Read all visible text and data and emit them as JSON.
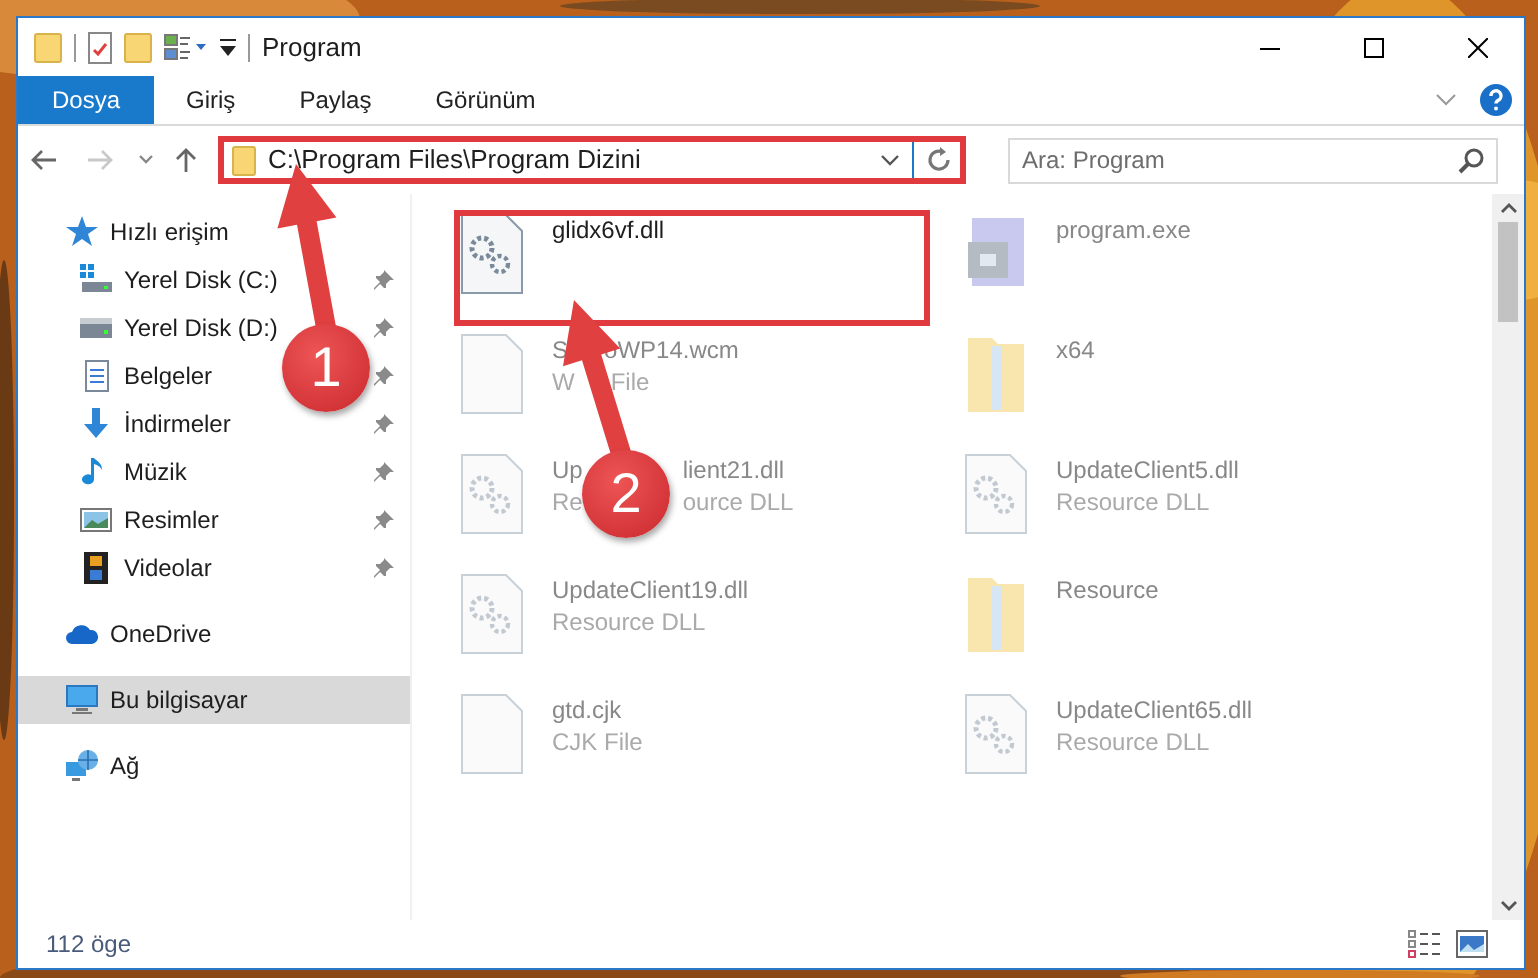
{
  "window": {
    "title": "Program"
  },
  "ribbon_tabs": [
    {
      "label": "Dosya",
      "selected": true
    },
    {
      "label": "Giriş",
      "selected": false
    },
    {
      "label": "Paylaş",
      "selected": false
    },
    {
      "label": "Görünüm",
      "selected": false
    }
  ],
  "address": {
    "path": "C:\\Program Files\\Program Dizini"
  },
  "search": {
    "placeholder": "Ara: Program"
  },
  "nav": [
    {
      "label": "Hızlı erişim",
      "kind": "header",
      "pinned": false,
      "selected": false
    },
    {
      "label": "Yerel Disk (C:)",
      "kind": "item",
      "pinned": true,
      "selected": false
    },
    {
      "label": "Yerel Disk (D:)",
      "kind": "item",
      "pinned": true,
      "selected": false
    },
    {
      "label": "Belgeler",
      "kind": "item",
      "pinned": true,
      "selected": false
    },
    {
      "label": "İndirmeler",
      "kind": "item",
      "pinned": true,
      "selected": false
    },
    {
      "label": "Müzik",
      "kind": "item",
      "pinned": true,
      "selected": false
    },
    {
      "label": "Resimler",
      "kind": "item",
      "pinned": true,
      "selected": false
    },
    {
      "label": "Videolar",
      "kind": "item",
      "pinned": true,
      "selected": false
    },
    {
      "label": "OneDrive",
      "kind": "header",
      "pinned": false,
      "selected": false
    },
    {
      "label": "Bu bilgisayar",
      "kind": "header",
      "pinned": false,
      "selected": true
    },
    {
      "label": "Ağ",
      "kind": "header",
      "pinned": false,
      "selected": false
    }
  ],
  "files": [
    {
      "name": [
        "glidx6vf.dll"
      ],
      "kind": "dll",
      "faded": false
    },
    {
      "name": [
        "program.exe"
      ],
      "kind": "exe",
      "faded": true
    },
    {
      "name": [
        "S",
        "oWP14.wcm"
      ],
      "type": [
        "W",
        "File"
      ],
      "kind": "file",
      "faded": true
    },
    {
      "name": [
        "x64"
      ],
      "kind": "folder",
      "faded": true
    },
    {
      "name": [
        "Up",
        "lient21.dll"
      ],
      "type": [
        "Re",
        "ource DLL"
      ],
      "kind": "dll",
      "faded": true
    },
    {
      "name": [
        "UpdateClient5.dll"
      ],
      "type": [
        "Resource DLL"
      ],
      "kind": "dll",
      "faded": true
    },
    {
      "name": [
        "UpdateClient19.dll"
      ],
      "type": [
        "Resource DLL"
      ],
      "kind": "dll",
      "faded": true
    },
    {
      "name": [
        "Resource"
      ],
      "kind": "folder",
      "faded": true
    },
    {
      "name": [
        "gtd.cjk"
      ],
      "type": [
        "CJK File"
      ],
      "kind": "file",
      "faded": true
    },
    {
      "name": [
        "UpdateClient65.dll"
      ],
      "type": [
        "Resource DLL"
      ],
      "kind": "dll",
      "faded": true
    }
  ],
  "annotations": [
    {
      "label": "1"
    },
    {
      "label": "2"
    }
  ],
  "status_bar": {
    "count": "112 öge"
  }
}
